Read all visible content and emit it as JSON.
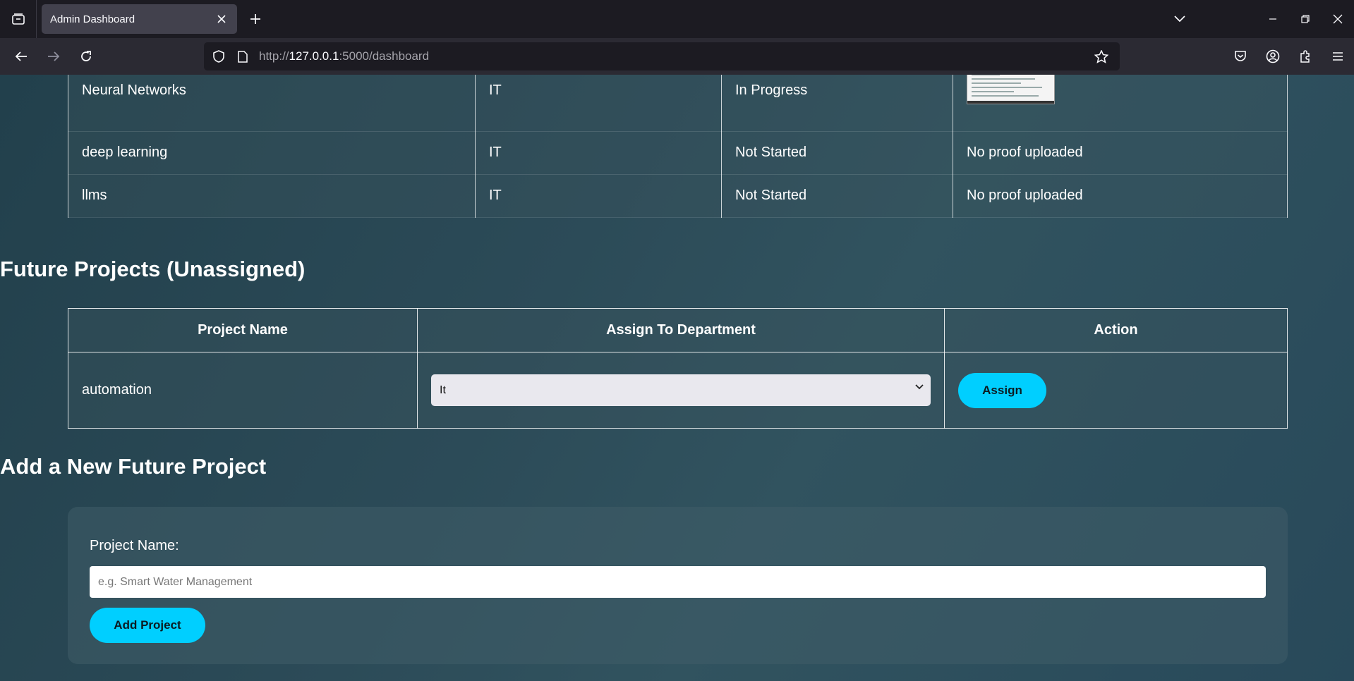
{
  "browser": {
    "tab_title": "Admin Dashboard",
    "url_prefix": "http://",
    "url_host": "127.0.0.1",
    "url_rest": ":5000/dashboard"
  },
  "assigned_projects": {
    "rows": [
      {
        "name": "Neural Networks",
        "department": "IT",
        "status": "In Progress",
        "proof": ""
      },
      {
        "name": "deep learning",
        "department": "IT",
        "status": "Not Started",
        "proof": "No proof uploaded"
      },
      {
        "name": "llms",
        "department": "IT",
        "status": "Not Started",
        "proof": "No proof uploaded"
      }
    ]
  },
  "future_projects": {
    "heading": "Future Projects (Unassigned)",
    "columns": [
      "Project Name",
      "Assign To Department",
      "Action"
    ],
    "rows": [
      {
        "name": "automation",
        "department_selected": "It",
        "action_label": "Assign"
      }
    ]
  },
  "add_project": {
    "heading": "Add a New Future Project",
    "label": "Project Name:",
    "placeholder": "e.g. Smart Water Management",
    "button_label": "Add Project"
  },
  "colors": {
    "accent": "#00cfff",
    "chrome_dark": "#1c1b22",
    "chrome_nav": "#2b2a33"
  }
}
